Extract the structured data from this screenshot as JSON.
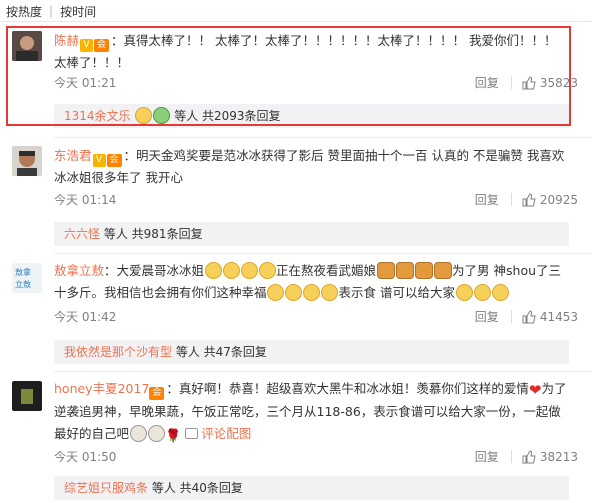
{
  "sort": {
    "hot": "按热度",
    "time": "按时间"
  },
  "comments": [
    {
      "user": "陈赫",
      "text": "：真得太棒了！！ 太棒了！太棒了！！！！！！太棒了！！！！ 我爱你们！！！ 太棒了！！！",
      "time": "今天 01:21",
      "reply": "回复",
      "likes": "35823",
      "sub": {
        "users": "1314余文乐",
        "rest": "等人 共2093条回复"
      }
    },
    {
      "user": "东浩君",
      "text": "：明天金鸡奖要是范冰冰获得了影后 赞里面抽十个一百 认真的 不是骗赞 我喜欢冰冰姐很多年了 我开心",
      "time": "今天 01:14",
      "reply": "回复",
      "likes": "20925",
      "sub": {
        "users": "六六怪",
        "rest": "等人 共981条回复"
      }
    },
    {
      "user": "敖拿立敖",
      "text_a": "：大爱晨哥冰冰姐",
      "text_b": "正在熬夜看武媚娘",
      "text_c": "为了男 神shou了三十多斤。我相信也会拥有你们这种幸福",
      "text_d": "表示食 谱可以给大家",
      "time": "今天 01:42",
      "reply": "回复",
      "likes": "41453",
      "sub": {
        "users": "我依然是那个沙有型",
        "rest": "等人 共47条回复"
      }
    },
    {
      "user": "honey丰夏2017",
      "text_a": "：真好啊！恭喜！超级喜欢大黑牛和冰冰姐！羡慕你们这样的爱情",
      "text_b": "为了逆袭追男神，早晚果蔬，午饭正常吃，三个月从118-86，表示食谱可以给大家一份，一起做最好的自己吧",
      "pic": "评论配图",
      "time": "今天 01:50",
      "reply": "回复",
      "likes": "38213",
      "sub": {
        "users": "综艺姐只服鸡条",
        "rest": "等人 共40条回复"
      }
    }
  ]
}
